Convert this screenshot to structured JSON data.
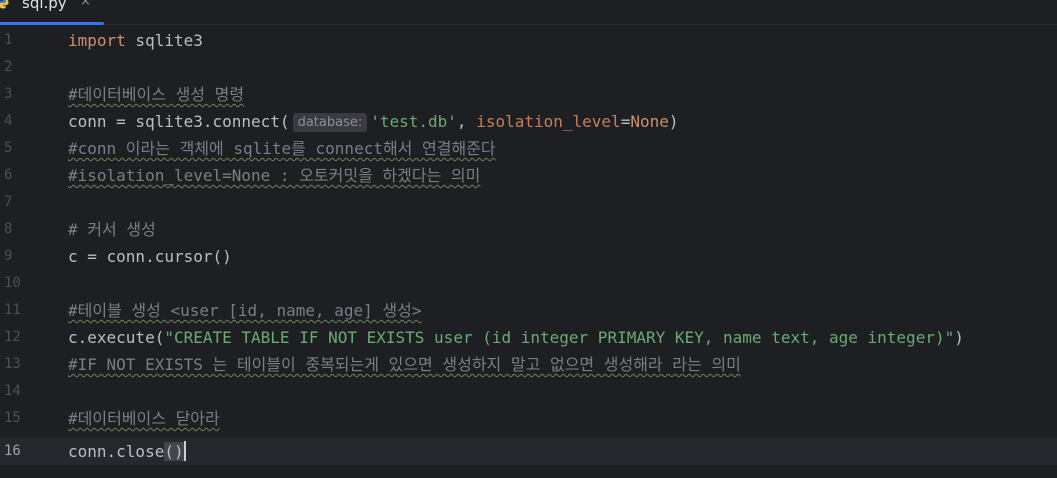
{
  "tab": {
    "filename": "sql.py",
    "close": "×"
  },
  "lines": [
    {
      "num": "1",
      "text": "import sqlite3"
    },
    {
      "num": "2",
      "text": ""
    },
    {
      "num": "3",
      "text": "#데이터베이스 생성 명령"
    },
    {
      "num": "4",
      "text": "conn = sqlite3.connect(database: 'test.db', isolation_level=None)"
    },
    {
      "num": "5",
      "text": "#conn 이라는 객체에 sqlite를 connect해서 연결해준다"
    },
    {
      "num": "6",
      "text": "#isolation_level=None : 오토커밋을 하겠다는 의미"
    },
    {
      "num": "7",
      "text": ""
    },
    {
      "num": "8",
      "text": "# 커서 생성"
    },
    {
      "num": "9",
      "text": "c = conn.cursor()"
    },
    {
      "num": "10",
      "text": ""
    },
    {
      "num": "11",
      "text": "#테이블 생성 <user [id, name, age] 생성>"
    },
    {
      "num": "12",
      "text": "c.execute(\"CREATE TABLE IF NOT EXISTS user (id integer PRIMARY KEY, name text, age integer)\")"
    },
    {
      "num": "13",
      "text": "#IF NOT EXISTS 는 테이블이 중복되는게 있으면 생성하지 말고 없으면 생성해라 라는 의미"
    },
    {
      "num": "14",
      "text": ""
    },
    {
      "num": "15",
      "text": "#데이터베이스 닫아라"
    },
    {
      "num": "16",
      "text": "conn.close()"
    }
  ],
  "tokens": {
    "l1_kw": "import",
    "l1_rest": " sqlite3",
    "l4_a": "conn = sqlite3.connect(",
    "l4_hint": "database:",
    "l4_str": "'test.db'",
    "l4_comma": ", ",
    "l4_param": "isolation_level",
    "l4_eq": "=",
    "l4_none": "None",
    "l4_close": ")",
    "l9": "c = conn.cursor()",
    "l12_a": "c.execute(",
    "l12_str": "\"CREATE TABLE IF NOT EXISTS user (id integer PRIMARY KEY, name text, age integer)\"",
    "l12_close": ")",
    "l16_a": "conn.close",
    "l16_open": "(",
    "l16_close": ")"
  },
  "colors": {
    "background": "#1e1f22",
    "current_line": "#26282e",
    "keyword": "#cf8e6d",
    "string": "#6aab73",
    "comment": "#7a7e85",
    "tab_accent": "#3574f0"
  }
}
